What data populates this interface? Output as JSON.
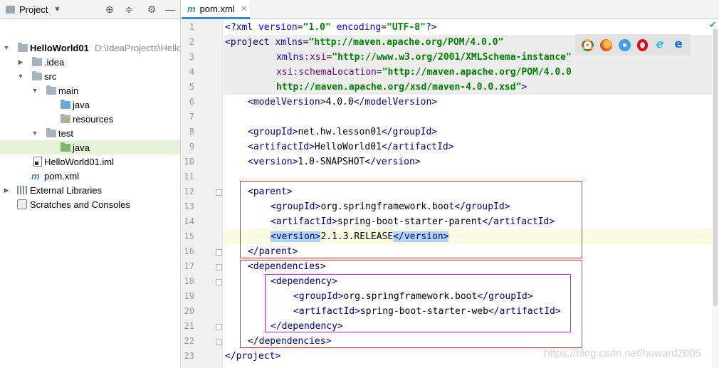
{
  "project_panel": {
    "title": "Project",
    "tree": [
      {
        "label": "HelloWorld01",
        "path": "D:\\IdeaProjects\\Hello"
      },
      {
        "label": ".idea"
      },
      {
        "label": "src"
      },
      {
        "label": "main"
      },
      {
        "label": "java"
      },
      {
        "label": "resources"
      },
      {
        "label": "test"
      },
      {
        "label": "java"
      },
      {
        "label": "HelloWorld01.iml"
      },
      {
        "label": "pom.xml"
      },
      {
        "label": "External Libraries"
      },
      {
        "label": "Scratches and Consoles"
      }
    ]
  },
  "editor": {
    "tab_label": "pom.xml",
    "line_numbers": [
      "1",
      "2",
      "3",
      "4",
      "5",
      "6",
      "7",
      "8",
      "9",
      "10",
      "11",
      "12",
      "13",
      "14",
      "15",
      "16",
      "17",
      "18",
      "19",
      "20",
      "21",
      "22",
      "23"
    ],
    "lines": [
      [
        "<?",
        "xml ",
        "version",
        "=",
        "\"1.0\"",
        " ",
        "encoding",
        "=",
        "\"UTF-8\"",
        "?>"
      ],
      [
        "<",
        "project ",
        "xmlns",
        "=",
        "\"http://maven.apache.org/POM/4.0.0\""
      ],
      [
        "xmlns",
        ":xsi",
        "=",
        "\"http://www.w3.org/2001/XMLSchema-instance\""
      ],
      [
        "xsi",
        ":schemaLocation",
        "=",
        "\"http://maven.apache.org/POM/4.0.0"
      ],
      [
        "http://maven.apache.org/xsd/maven-4.0.0.xsd\"",
        ">"
      ],
      [
        "<modelVersion>",
        "4.0.0",
        "</modelVersion>"
      ],
      [],
      [
        "<groupId>",
        "net.hw.lesson01",
        "</groupId>"
      ],
      [
        "<artifactId>",
        "HelloWorld01",
        "</artifactId>"
      ],
      [
        "<version>",
        "1.0-SNAPSHOT",
        "</version>"
      ],
      [],
      [
        "<parent>"
      ],
      [
        "<groupId>",
        "org.springframework.boot",
        "</groupId>"
      ],
      [
        "<artifactId>",
        "spring-boot-starter-parent",
        "</artifactId>"
      ],
      [
        "<version>",
        "2.1.3.RELEASE",
        "</version>"
      ],
      [
        "</parent>"
      ],
      [
        "<dependencies>"
      ],
      [
        "<dependency>"
      ],
      [
        "<groupId>",
        "org.springframework.boot",
        "</groupId>"
      ],
      [
        "<artifactId>",
        "spring-boot-starter-web",
        "</artifactId>"
      ],
      [
        "</dependency>"
      ],
      [
        "</dependencies>"
      ],
      [
        "</project>"
      ]
    ]
  },
  "browser_icons": [
    "chrome-icon",
    "firefox-icon",
    "safari-icon",
    "opera-icon",
    "ie-icon",
    "edge-icon"
  ],
  "watermark": "https://blog.csdn.net/howard2005",
  "colors": {
    "tag": "#000080",
    "attr": "#0000ff",
    "value": "#008000",
    "box_red": "#e23030",
    "box_purple": "#b030c8"
  }
}
